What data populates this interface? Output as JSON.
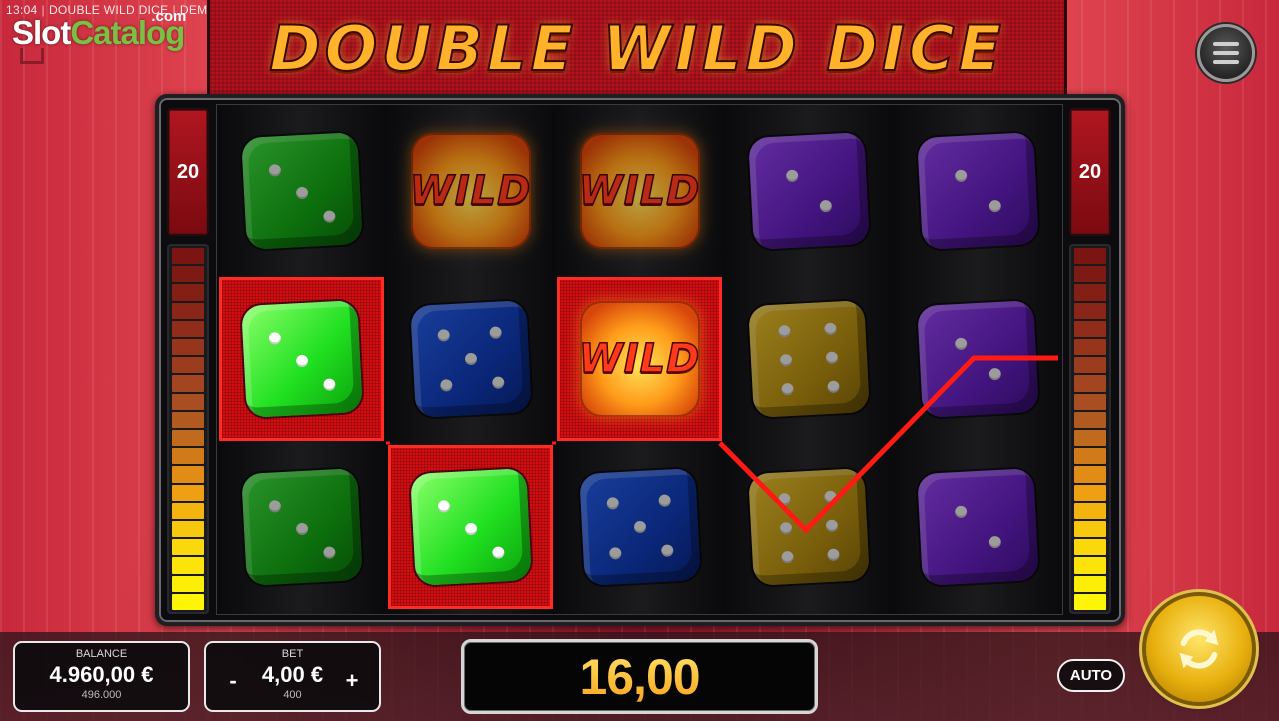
{
  "hud": {
    "time": "13:04",
    "game_name": "DOUBLE WILD DICE",
    "mode": "DEMO"
  },
  "watermark": {
    "part1": "Slot",
    "part2": "Catalog",
    "suffix": ".com"
  },
  "title": "DOUBLE WILD DICE",
  "lines": {
    "left": "20",
    "right": "20"
  },
  "reels": [
    [
      {
        "type": "die",
        "color": "green",
        "face": 3
      },
      {
        "type": "die",
        "color": "green",
        "face": 3,
        "win": true
      },
      {
        "type": "die",
        "color": "green",
        "face": 3
      }
    ],
    [
      {
        "type": "wild"
      },
      {
        "type": "die",
        "color": "blue",
        "face": 5
      },
      {
        "type": "die",
        "color": "green",
        "face": 3,
        "win": true
      }
    ],
    [
      {
        "type": "wild"
      },
      {
        "type": "wild",
        "win": true
      },
      {
        "type": "die",
        "color": "blue",
        "face": 5
      }
    ],
    [
      {
        "type": "die",
        "color": "purple",
        "face": 2
      },
      {
        "type": "die",
        "color": "yellow",
        "face": 6
      },
      {
        "type": "die",
        "color": "yellow",
        "face": 6
      }
    ],
    [
      {
        "type": "die",
        "color": "purple",
        "face": 2
      },
      {
        "type": "die",
        "color": "purple",
        "face": 2
      },
      {
        "type": "die",
        "color": "purple",
        "face": 2
      }
    ]
  ],
  "meter_colors": [
    "#7a1512",
    "#7e1a14",
    "#841f16",
    "#8a2618",
    "#902d1a",
    "#96341c",
    "#9c3c1e",
    "#a24520",
    "#a84e22",
    "#b05a22",
    "#c06a1e",
    "#d07a1a",
    "#e08c16",
    "#eea012",
    "#f4b410",
    "#f8c80e",
    "#fad80c",
    "#fce40a",
    "#fdee08",
    "#fef406"
  ],
  "colors": {
    "accent": "#ffb22a",
    "win_frame": "#d40d12",
    "payline": "#ff1a14",
    "win_text": "#f7a21a"
  },
  "bottom": {
    "balance": {
      "label": "BALANCE",
      "value": "4.960,00 €",
      "sub": "496.000"
    },
    "bet": {
      "label": "BET",
      "minus": "-",
      "value": "4,00 €",
      "plus": "+",
      "sub": "400"
    },
    "win": "16,00",
    "auto": "AUTO"
  },
  "icons": {
    "menu": "hamburger-icon",
    "spin": "spin-arrows-icon",
    "fullscreen": "fullscreen-icon"
  }
}
